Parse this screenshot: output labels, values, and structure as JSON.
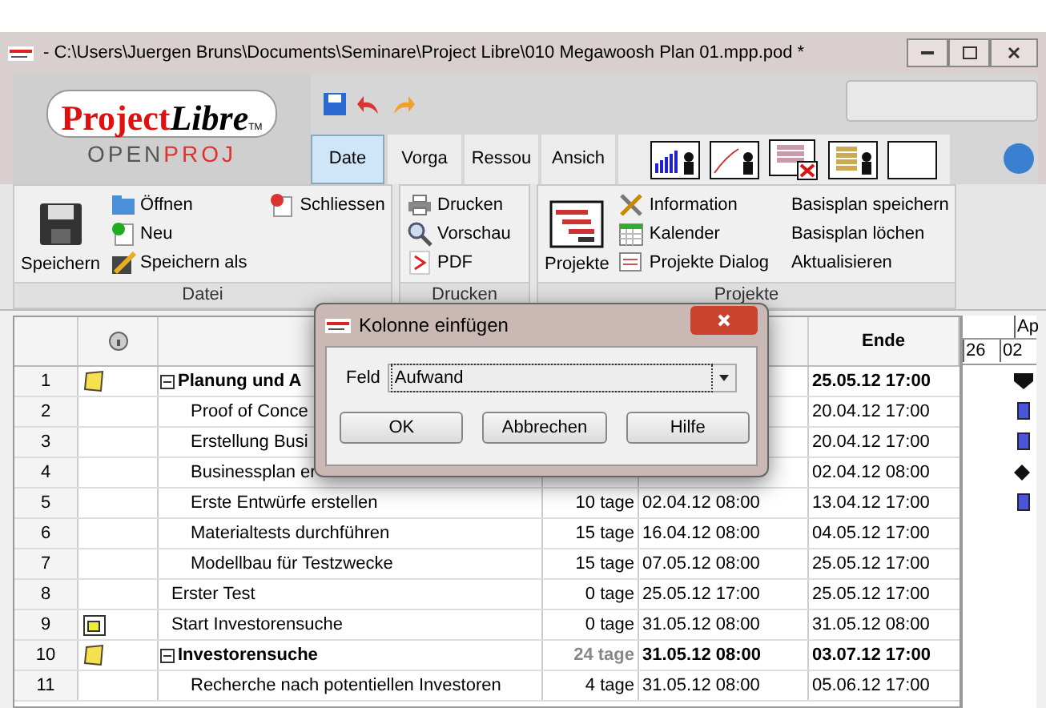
{
  "window": {
    "title": "- C:\\Users\\Juergen Bruns\\Documents\\Seminare\\Project Libre\\010 Megawoosh Plan 01.mpp.pod *"
  },
  "logo": {
    "part1": "Project",
    "part2": "Libre",
    "tm": "TM",
    "sub1": "OPEN",
    "sub2": "PROJ"
  },
  "tabs": [
    {
      "label": "Date",
      "selected": true
    },
    {
      "label": "Vorga",
      "selected": false
    },
    {
      "label": "Ressou",
      "selected": false
    },
    {
      "label": "Ansich",
      "selected": false
    }
  ],
  "ribbon": [
    {
      "title": "Datei",
      "big": {
        "label": "Speichern"
      },
      "columns": [
        [
          {
            "label": "Öffnen"
          },
          {
            "label": "Neu"
          },
          {
            "label": "Speichern als"
          }
        ],
        [
          {
            "label": "Schliessen"
          }
        ]
      ]
    },
    {
      "title": "Drucken",
      "columns": [
        [
          {
            "label": "Drucken"
          },
          {
            "label": "Vorschau"
          },
          {
            "label": "PDF"
          }
        ]
      ]
    },
    {
      "title": "Projekte",
      "big": {
        "label": "Projekte"
      },
      "columns": [
        [
          {
            "label": "Information"
          },
          {
            "label": "Kalender"
          },
          {
            "label": "Projekte Dialog"
          }
        ],
        [
          {
            "label": "Basisplan speichern"
          },
          {
            "label": "Basisplan löchen"
          },
          {
            "label": "Aktualisieren"
          }
        ]
      ]
    }
  ],
  "table": {
    "columns": [
      "",
      "",
      "",
      "",
      "",
      "Ende"
    ],
    "rows": [
      {
        "num": "1",
        "kind": "note",
        "name": "Planung und A",
        "ende": "25.05.12 17:00",
        "expanded": true,
        "children": [
          {
            "num": "2",
            "name": "Proof of Conce",
            "ende": "20.04.12 17:00"
          },
          {
            "num": "3",
            "name": "Erstellung Busi",
            "ende": "20.04.12 17:00"
          },
          {
            "num": "4",
            "name": "Businessplan er",
            "ende": "02.04.12 08:00"
          },
          {
            "num": "5",
            "name": "Erste Entwürfe erstellen",
            "dauer": "10 tage",
            "start": "02.04.12 08:00",
            "ende": "13.04.12 17:00"
          },
          {
            "num": "6",
            "name": "Materialtests durchführen",
            "dauer": "15 tage",
            "start": "16.04.12 08:00",
            "ende": "04.05.12 17:00"
          },
          {
            "num": "7",
            "name": "Modellbau für Testzwecke",
            "dauer": "15 tage",
            "start": "07.05.12 08:00",
            "ende": "25.05.12 17:00"
          }
        ]
      },
      {
        "num": "8",
        "name": "Erster Test",
        "dauer": "0 tage",
        "start": "25.05.12 17:00",
        "ende": "25.05.12 17:00"
      },
      {
        "num": "9",
        "kind": "calendar",
        "name": "Start Investorensuche",
        "dauer": "0 tage",
        "start": "31.05.12 08:00",
        "ende": "31.05.12 08:00"
      },
      {
        "num": "10",
        "kind": "note",
        "name": "Investorensuche",
        "dauer": "24 tage",
        "start": "31.05.12 08:00",
        "ende": "03.07.12 17:00",
        "expanded": true,
        "children": [
          {
            "num": "11",
            "name": "Recherche nach potentiellen Investoren",
            "dauer": "4 tage",
            "start": "31.05.12 08:00",
            "ende": "05.06.12 17:00"
          }
        ]
      }
    ]
  },
  "gantt": {
    "month": "Ap",
    "days": [
      "26",
      "02"
    ],
    "bars": [
      {
        "kind": "summary"
      },
      {
        "kind": "task"
      },
      {
        "kind": "task"
      },
      {
        "kind": "milestone"
      },
      {
        "kind": "task"
      }
    ]
  },
  "dialog": {
    "title": "Kolonne einfügen",
    "field_label": "Feld",
    "field_value": "Aufwand",
    "buttons": [
      "OK",
      "Abbrechen",
      "Hilfe"
    ]
  }
}
